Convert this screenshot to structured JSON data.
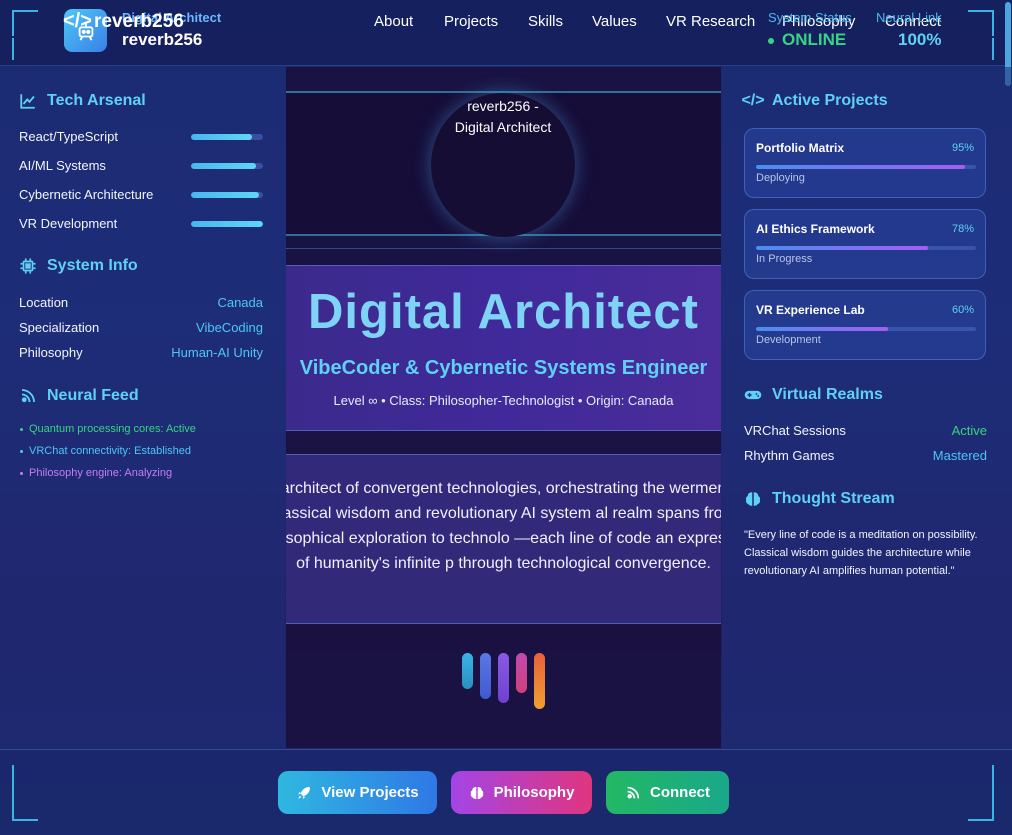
{
  "header": {
    "logo_icon": "code-icon",
    "brand_ghost": "Digital Architect",
    "brand_name": "reverb256",
    "brand_name_2": "reverb256",
    "nav": [
      "About",
      "Projects",
      "Skills",
      "Values",
      "VR Research",
      "Philosophy",
      "Connect"
    ],
    "status": {
      "system_label": "System Status",
      "system_value": "ONLINE",
      "neural_label": "Neural Link",
      "neural_value": "100%"
    }
  },
  "left": {
    "tech_title": "Tech Arsenal",
    "skills": [
      {
        "label": "React/TypeScript",
        "level": 0.85
      },
      {
        "label": "AI/ML Systems",
        "level": 0.9
      },
      {
        "label": "Cybernetic Architecture",
        "level": 0.95
      },
      {
        "label": "VR Development",
        "level": 1.0
      }
    ],
    "info_title": "System Info",
    "info": [
      {
        "label": "Location",
        "value": "Canada"
      },
      {
        "label": "Specialization",
        "value": "VibeCoding"
      },
      {
        "label": "Philosophy",
        "value": "Human-AI Unity"
      }
    ],
    "feed_title": "Neural Feed",
    "feed": [
      {
        "text": "Quantum processing cores: Active",
        "color": "#37d483"
      },
      {
        "text": "VRChat connectivity: Established",
        "color": "#4cc7f5"
      },
      {
        "text": "Philosophy engine: Analyzing",
        "color": "#c77df2"
      }
    ]
  },
  "center": {
    "avatar_text": "reverb256 - Digital Architect",
    "title": "Digital Architect",
    "subtitle": "VibeCoder & Cybernetic Systems Engineer",
    "meta": "Level ∞ • Class: Philosopher-Technologist • Origin: Canada",
    "bio": "an architect of convergent technologies, orchestrating the werment of classical wisdom and revolutionary AI system al realm spans from philosophical exploration to technolo —each line of code an expression of humanity's infinite p through technological convergence."
  },
  "right": {
    "projects_title": "Active Projects",
    "projects": [
      {
        "name": "Portfolio Matrix",
        "percent": "95%",
        "progress": 0.95,
        "status": "Deploying"
      },
      {
        "name": "AI Ethics Framework",
        "percent": "78%",
        "progress": 0.78,
        "status": "In Progress"
      },
      {
        "name": "VR Experience Lab",
        "percent": "60%",
        "progress": 0.6,
        "status": "Development"
      }
    ],
    "realms_title": "Virtual Realms",
    "realms": [
      {
        "label": "VRChat Sessions",
        "value": "Active",
        "color": "#37d483"
      },
      {
        "label": "Rhythm Games",
        "value": "Mastered",
        "color": "#4cc7f5"
      }
    ],
    "thought_title": "Thought Stream",
    "quote": "\"Every line of code is a meditation on possibility. Classical wisdom guides the architecture while revolutionary AI amplifies human potential.\""
  },
  "footer": {
    "buttons": [
      {
        "label": "View Projects",
        "icon": "rocket-icon"
      },
      {
        "label": "Philosophy",
        "icon": "brain-icon"
      },
      {
        "label": "Connect",
        "icon": "link-icon"
      }
    ]
  },
  "colors": {
    "accent": "#5fd1f5",
    "online": "#37d483",
    "background": "#1f2d78"
  }
}
